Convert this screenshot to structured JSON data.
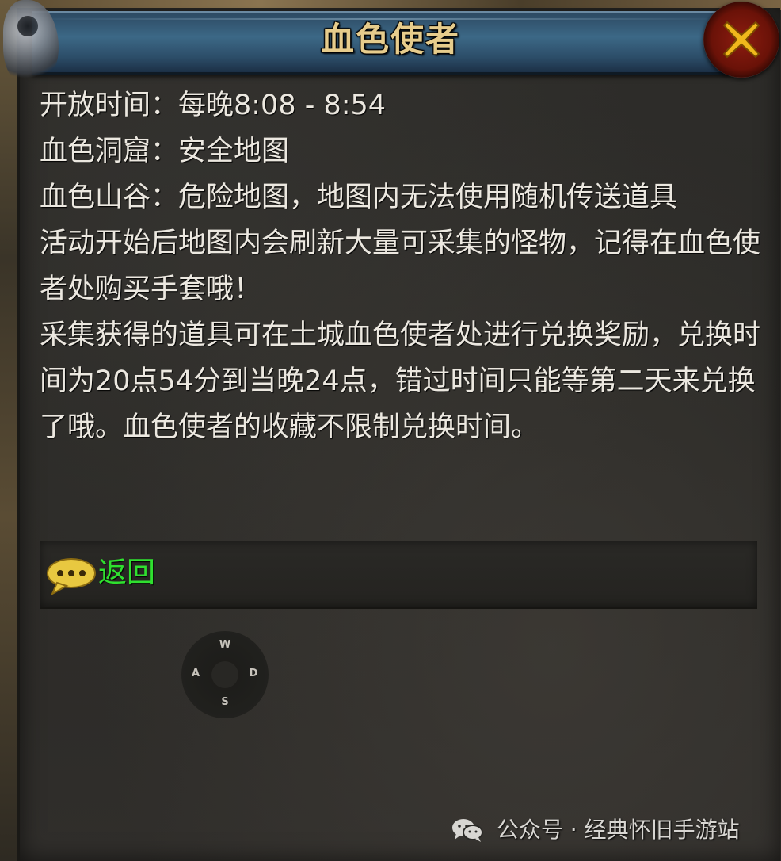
{
  "dialog": {
    "title": "血色使者",
    "lines": [
      "开放时间：每晚8:08 - 8:54",
      "血色洞窟：安全地图",
      "血色山谷：危险地图，地图内无法使用随机传送道具",
      "活动开始后地图内会刷新大量可采集的怪物，记得在血色使者处购买手套哦！",
      "采集获得的道具可在土城血色使者处进行兑换奖励，兑换时间为20点54分到当晚24点，错过时间只能等第二天来兑换了哦。血色使者的收藏不限制兑换时间。"
    ],
    "return_label": "返回",
    "close_icon": "close-icon"
  },
  "dpad": {
    "up": "W",
    "left": "A",
    "right": "D",
    "down": "S"
  },
  "watermark": {
    "text": "公众号 · 经典怀旧手游站"
  },
  "colors": {
    "title_text": "#e6cc8c",
    "title_bar": "#3c6886",
    "body_text": "#ece8e0",
    "return_link": "#2fe02f",
    "close_button": "#8c1c10",
    "close_x": "#f0b81c"
  }
}
